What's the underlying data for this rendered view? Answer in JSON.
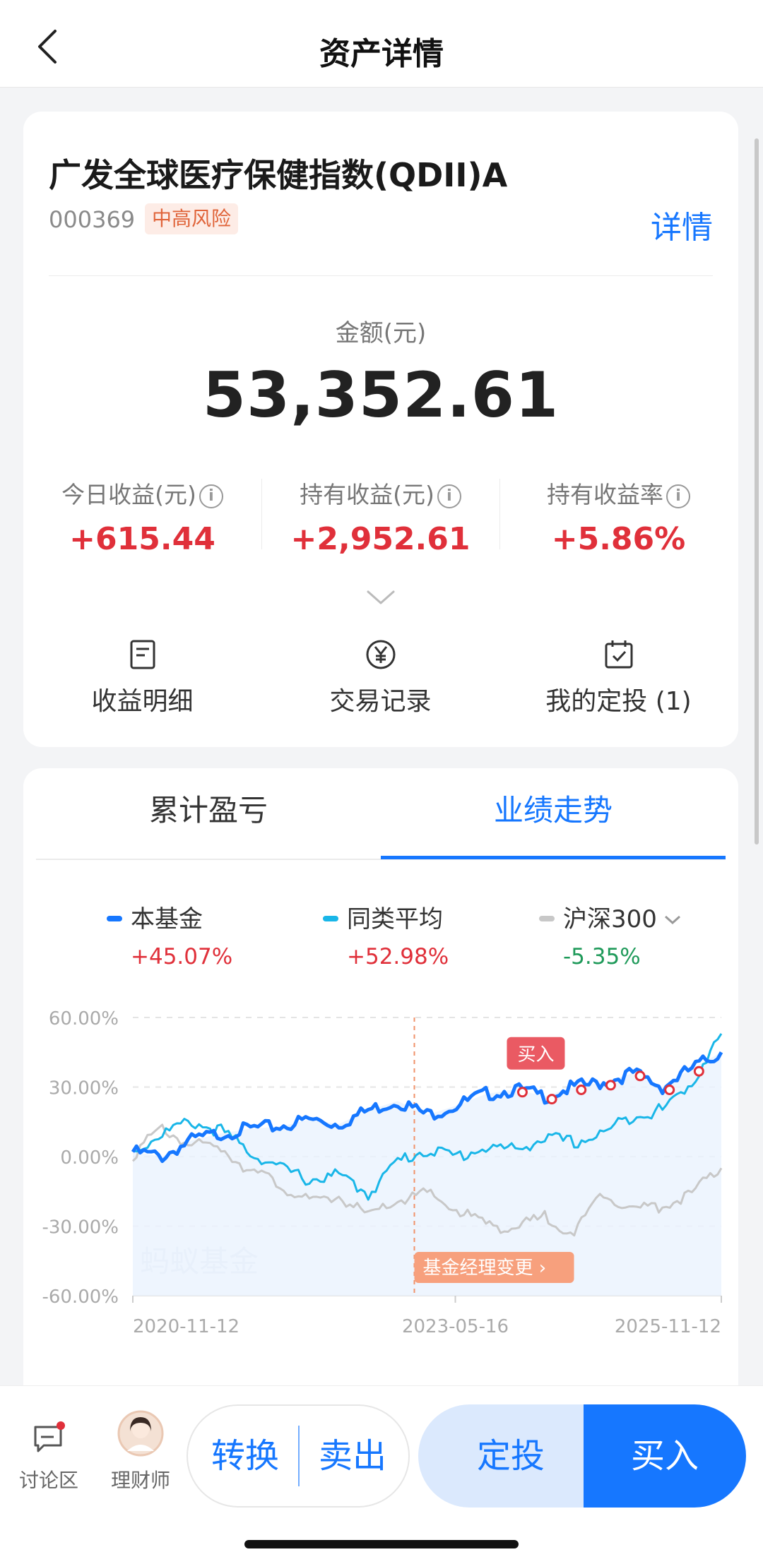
{
  "nav": {
    "title": "资产详情"
  },
  "fund": {
    "name": "广发全球医疗保健指数(QDII)A",
    "code": "000369",
    "risk": "中高风险",
    "detail_link": "详情"
  },
  "amount": {
    "label": "金额(元)",
    "value": "53,352.61"
  },
  "stats": [
    {
      "label": "今日收益(元)",
      "value": "+615.44"
    },
    {
      "label": "持有收益(元)",
      "value": "+2,952.61"
    },
    {
      "label": "持有收益率",
      "value": "+5.86%"
    }
  ],
  "actions": [
    {
      "label": "收益明细",
      "icon": "document-icon"
    },
    {
      "label": "交易记录",
      "icon": "yen-circle-icon"
    },
    {
      "label": "我的定投 (1)",
      "icon": "calendar-check-icon"
    }
  ],
  "tabs": [
    {
      "label": "累计盈亏"
    },
    {
      "label": "业绩走势",
      "active": true
    }
  ],
  "legend": [
    {
      "name": "本基金",
      "value": "+45.07%",
      "color": "#1677ff",
      "value_color": "#e0303a"
    },
    {
      "name": "同类平均",
      "value": "+52.98%",
      "color": "#19b6e8",
      "value_color": "#e0303a"
    },
    {
      "name": "沪深300",
      "value": "-5.35%",
      "color": "#c8c8c8",
      "value_color": "#1f9a5a"
    }
  ],
  "chart_data": {
    "type": "line",
    "y_ticks": [
      "60.00%",
      "30.00%",
      "0.00%",
      "-30.00%",
      "-60.00%"
    ],
    "ylim": [
      -60,
      60
    ],
    "x_ticks": [
      "2020-11-12",
      "2023-05-16",
      "2025-11-12"
    ],
    "x": [
      "2020-11",
      "2021-02",
      "2021-05",
      "2021-08",
      "2021-11",
      "2022-02",
      "2022-05",
      "2022-08",
      "2022-11",
      "2023-02",
      "2023-05",
      "2023-08",
      "2023-11",
      "2024-02",
      "2024-05",
      "2024-08",
      "2024-11",
      "2025-02",
      "2025-05",
      "2025-08",
      "2025-11"
    ],
    "series": [
      {
        "name": "本基金",
        "values": [
          2,
          0,
          7,
          10,
          12,
          13,
          16,
          14,
          20,
          24,
          18,
          22,
          27,
          29,
          26,
          30,
          32,
          36,
          30,
          38,
          45
        ]
      },
      {
        "name": "同类平均",
        "values": [
          2,
          10,
          15,
          11,
          2,
          -5,
          -10,
          -8,
          -16,
          -2,
          3,
          0,
          4,
          3,
          8,
          6,
          10,
          18,
          20,
          32,
          53
        ]
      },
      {
        "name": "沪深300",
        "values": [
          1,
          12,
          5,
          4,
          -6,
          -12,
          -20,
          -17,
          -26,
          -19,
          -16,
          -23,
          -29,
          -31,
          -26,
          -33,
          -15,
          -23,
          -21,
          -16,
          -5
        ]
      }
    ],
    "annotations": {
      "buy": "买入",
      "manager_change": "基金经理变更",
      "watermark": "蚂蚁基金"
    }
  },
  "bottom": {
    "discuss": "讨论区",
    "advisor": "理财师",
    "convert": "转换",
    "sell": "卖出",
    "plan": "定投",
    "buy": "买入"
  }
}
